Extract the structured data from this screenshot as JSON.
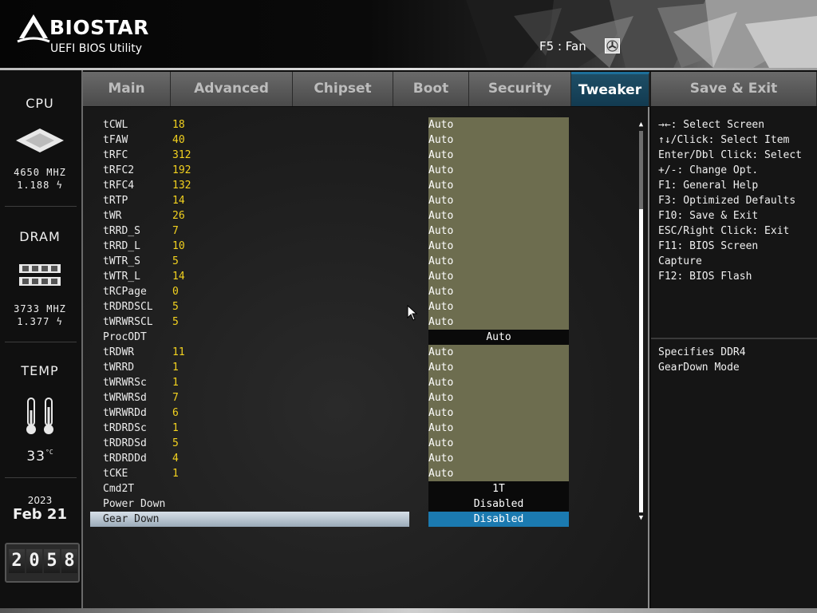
{
  "header": {
    "brand": "BIOSTAR",
    "subtitle": "UEFI BIOS Utility",
    "fan_hint": "F5 : Fan",
    "fan_icon": "fan-icon"
  },
  "sidebar": {
    "cpu": {
      "title": "CPU",
      "freq": "4650 MHZ",
      "volt": "1.188",
      "icon": "cpu-chip-icon"
    },
    "dram": {
      "title": "DRAM",
      "freq": "3733 MHZ",
      "volt": "1.377",
      "icon": "memory-module-icon"
    },
    "temp": {
      "title": "TEMP",
      "value": "33",
      "unit": "°C",
      "icon": "thermometer-icon"
    },
    "date": {
      "year": "2023",
      "month_day": "Feb 21"
    },
    "clock": {
      "digits": [
        "2",
        "0",
        "5",
        "8"
      ]
    }
  },
  "tabs": [
    {
      "label": "Main",
      "active": false
    },
    {
      "label": "Advanced",
      "active": false
    },
    {
      "label": "Chipset",
      "active": false
    },
    {
      "label": "Boot",
      "active": false
    },
    {
      "label": "Security",
      "active": false
    },
    {
      "label": "Tweaker",
      "active": true
    },
    {
      "label": "Save & Exit",
      "active": false
    }
  ],
  "settings": [
    {
      "label": "tCWL",
      "current": "18",
      "value": "Auto"
    },
    {
      "label": "tFAW",
      "current": "40",
      "value": "Auto"
    },
    {
      "label": "tRFC",
      "current": "312",
      "value": "Auto"
    },
    {
      "label": "tRFC2",
      "current": "192",
      "value": "Auto"
    },
    {
      "label": "tRFC4",
      "current": "132",
      "value": "Auto"
    },
    {
      "label": "tRTP",
      "current": "14",
      "value": "Auto"
    },
    {
      "label": "tWR",
      "current": "26",
      "value": "Auto"
    },
    {
      "label": "tRRD_S",
      "current": "7",
      "value": "Auto"
    },
    {
      "label": "tRRD_L",
      "current": "10",
      "value": "Auto"
    },
    {
      "label": "tWTR_S",
      "current": "5",
      "value": "Auto"
    },
    {
      "label": "tWTR_L",
      "current": "14",
      "value": "Auto"
    },
    {
      "label": "tRCPage",
      "current": "0",
      "value": "Auto"
    },
    {
      "label": "tRDRDSCL",
      "current": "5",
      "value": "Auto"
    },
    {
      "label": "tWRWRSCL",
      "current": "5",
      "value": "Auto"
    },
    {
      "label": "ProcODT",
      "current": "",
      "value": "Auto",
      "style": "dark"
    },
    {
      "label": "tRDWR",
      "current": "11",
      "value": "Auto"
    },
    {
      "label": "tWRRD",
      "current": "1",
      "value": "Auto"
    },
    {
      "label": "tWRWRSc",
      "current": "1",
      "value": "Auto"
    },
    {
      "label": "tWRWRSd",
      "current": "7",
      "value": "Auto"
    },
    {
      "label": "tWRWRDd",
      "current": "6",
      "value": "Auto"
    },
    {
      "label": "tRDRDSc",
      "current": "1",
      "value": "Auto"
    },
    {
      "label": "tRDRDSd",
      "current": "5",
      "value": "Auto"
    },
    {
      "label": "tRDRDDd",
      "current": "4",
      "value": "Auto"
    },
    {
      "label": "tCKE",
      "current": "1",
      "value": "Auto"
    },
    {
      "label": "Cmd2T",
      "current": "",
      "value": "1T",
      "style": "dark"
    },
    {
      "label": "Power Down",
      "current": "",
      "value": "Disabled",
      "style": "dark"
    },
    {
      "label": "Gear Down",
      "current": "",
      "value": "Disabled",
      "style": "selected"
    }
  ],
  "help": {
    "keys": [
      "→←: Select Screen",
      "↑↓/Click: Select Item",
      "Enter/Dbl Click: Select",
      "+/-: Change Opt.",
      "F1: General Help",
      "F3: Optimized Defaults",
      "F10: Save & Exit",
      "ESC/Right Click: Exit",
      "F11: BIOS Screen",
      "Capture",
      "F12: BIOS Flash"
    ],
    "description": [
      "Specifies DDR4",
      "GearDown Mode"
    ]
  },
  "colors": {
    "accent": "#1b7ab0",
    "current_value": "#f3d21f",
    "option_bg": "#6d6d4f",
    "tab_active": "#1e4e66"
  }
}
